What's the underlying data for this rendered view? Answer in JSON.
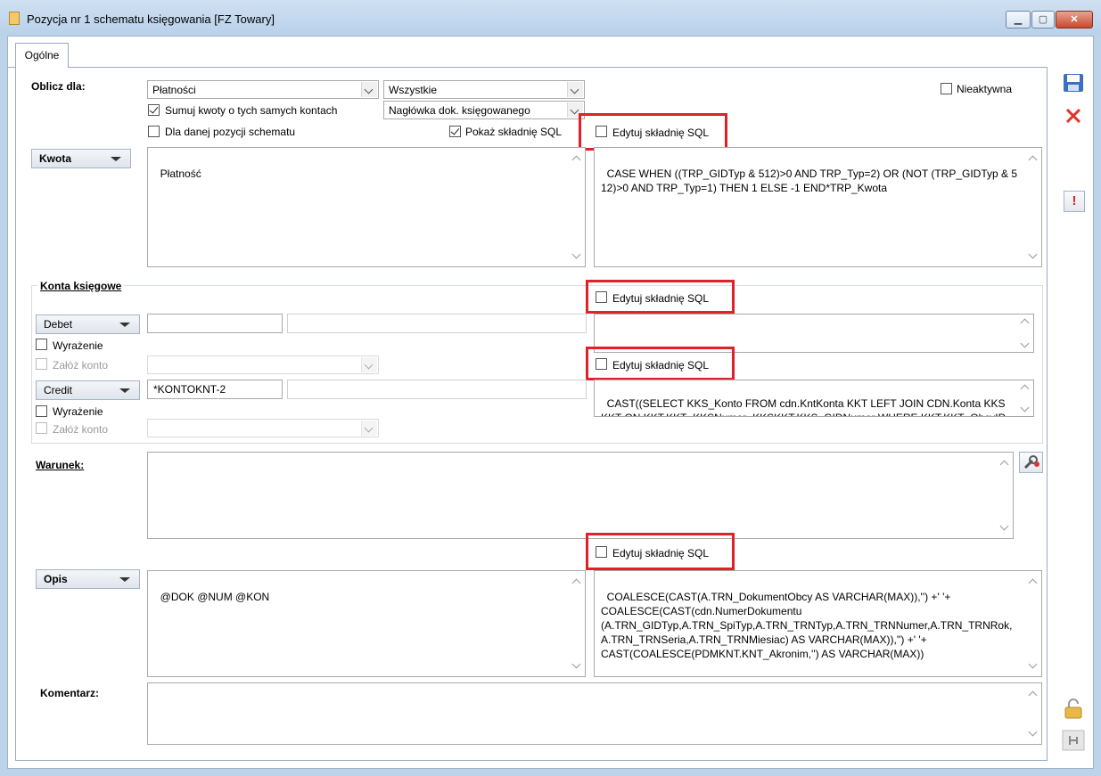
{
  "window": {
    "title": "Pozycja nr 1 schematu księgowania [FZ Towary]",
    "min": "▁",
    "max": "▢",
    "close": "✕"
  },
  "tabs": [
    {
      "label": "Ogólne"
    }
  ],
  "oblicz": {
    "label": "Oblicz dla:",
    "platnosci": "Płatności",
    "wszystkie": "Wszystkie",
    "sumuj": "Sumuj kwoty o tych samych kontach",
    "naglowka": "Nagłówka dok. księgowanego",
    "dla_danej": "Dla danej pozycji schematu",
    "pokaz_sql": "Pokaż składnię SQL",
    "nieaktywna": "Nieaktywna"
  },
  "edytuj_sql": "Edytuj składnię SQL",
  "kwota": {
    "button": "Kwota",
    "text": "Płatność",
    "sql": "CASE WHEN ((TRP_GIDTyp & 512)>0 AND TRP_Typ=2) OR (NOT (TRP_GIDTyp & 512)>0 AND TRP_Typ=1) THEN 1 ELSE -1 END*TRP_Kwota"
  },
  "konta": {
    "title": "Konta księgowe",
    "debet": "Debet",
    "credit": "Credit",
    "wyrazenie": "Wyrażenie",
    "zaloz": "Załóż konto",
    "credit_value": "*KONTOKNT-2",
    "credit_sql": "CAST((SELECT KKS_Konto FROM cdn.KntKonta KKT LEFT JOIN CDN.Konta KKSKKT ON KKT.KKT_KKSNumer=KKSKKT.KKS_GIDNumer WHERE KKT.KKT_ObcyID=ObcyID and KKT.KKT_KntTyp=KntTyp and"
  },
  "warunek": {
    "label": "Warunek:"
  },
  "opis": {
    "button": "Opis",
    "text": "@DOK @NUM @KON",
    "sql": "COALESCE(CAST(A.TRN_DokumentObcy AS VARCHAR(MAX)),'') +' '+\nCOALESCE(CAST(cdn.NumerDokumentu\n(A.TRN_GIDTyp,A.TRN_SpiTyp,A.TRN_TRNTyp,A.TRN_TRNNumer,A.TRN_TRNRok,A.TRN_TRNSeria,A.TRN_TRNMiesiac) AS VARCHAR(MAX)),'') +' '+\nCAST(COALESCE(PDMKNT.KNT_Akronim,'') AS VARCHAR(MAX))"
  },
  "komentarz": {
    "label": "Komentarz:"
  },
  "toolbar": {
    "save_icon": "floppy-disk-icon",
    "cancel_icon": "red-x-icon",
    "warning_icon": "exclamation-icon",
    "lock_icon": "padlock-icon",
    "pin_icon": "pin-icon"
  },
  "colors": {
    "accent_red": "#e0202a",
    "title_bg": "#bcd3ea"
  }
}
